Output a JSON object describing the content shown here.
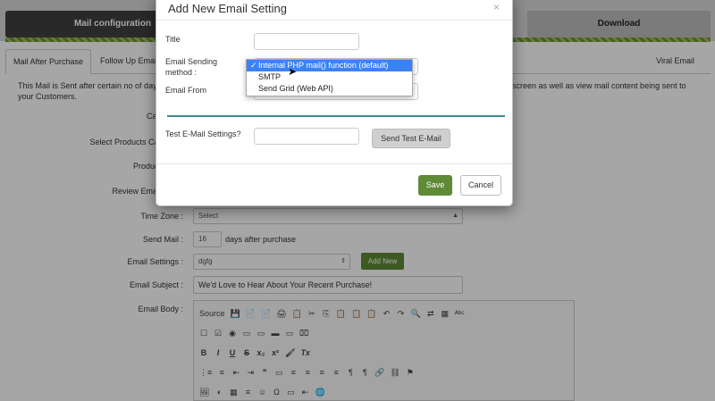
{
  "steps": {
    "active": "Mail configuration",
    "last": "Download"
  },
  "tabs": [
    "Mail After Purchase",
    "Follow Up Email",
    "Viral Email"
  ],
  "description": {
    "line1": "This Mail is Sent after certain no of days",
    "line1_right": "screen as well as view mail content being sent to",
    "line2": "your Customers."
  },
  "form": {
    "campaign_label": "Campaign",
    "select_products_label": "Select Products Cat",
    "product_label": "Product",
    "review_email_label": "Review Email",
    "timezone_label": "Time Zone :",
    "timezone_value": "Select",
    "send_mail_label": "Send Mail :",
    "send_mail_value": "16",
    "days_after": "days after purchase",
    "email_settings_label": "Email Settings :",
    "email_settings_value": "dgfg",
    "add_new_label": "Add New",
    "email_subject_label": "Email Subject :",
    "email_subject_value": "We'd Love to Hear About Your Recent Purchase!",
    "email_body_label": "Email Body :"
  },
  "editor": {
    "row1": [
      "Source",
      "💾",
      "📄",
      "📄",
      "🖨",
      "📋",
      "✂",
      "⎘",
      "📋",
      "📋",
      "📋",
      "↶",
      "↷",
      "🔍",
      "⇄",
      "▦",
      "ᴬᵇᶜ"
    ],
    "row2": [
      "☐",
      "☑",
      "◉",
      "▭",
      "▭",
      "▬",
      "▭",
      "⌧"
    ],
    "row3": [
      "B",
      "I",
      "U",
      "S",
      "x₂",
      "x²",
      "🖌",
      "Tx"
    ],
    "row4": [
      "⋮≡",
      "≡",
      "⇤",
      "⇥",
      "❞",
      "▭",
      "≡",
      "≡",
      "≡",
      "≡",
      "¶",
      "¶",
      "🔗",
      "⛓",
      "⚑"
    ],
    "row5": [
      "🖼",
      "◐",
      "▦",
      "≡",
      "☺",
      "Ω",
      "▭",
      "⇤",
      "🌐"
    ]
  },
  "modal": {
    "title": "Add New Email Setting",
    "close": "×",
    "title_label": "Title",
    "method_label_1": "Email Sending",
    "method_label_2": "method :",
    "email_from_label": "Email From",
    "test_label": "Test E-Mail Settings?",
    "test_button": "Send Test E-Mail",
    "save_button": "Save",
    "cancel_button": "Cancel"
  },
  "dropdown": {
    "options": [
      "Internal PHP mail() function (default)",
      "SMTP",
      "Send Grid (Web API)"
    ],
    "selected_index": 0,
    "check": "✓"
  },
  "colors": {
    "accent_green": "#5f8a36",
    "selection_blue": "#3b82f6",
    "teal": "#3f8a8a"
  }
}
